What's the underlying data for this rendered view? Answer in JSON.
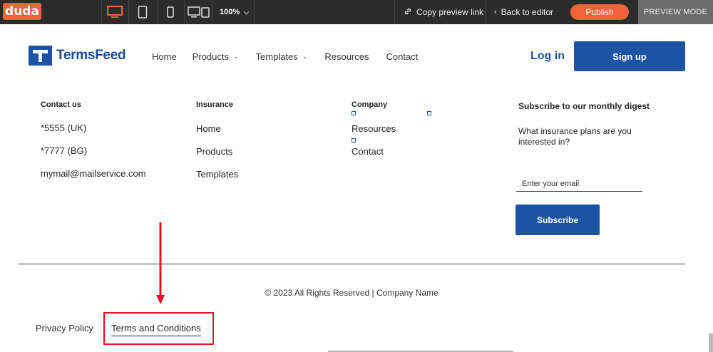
{
  "editor": {
    "logo": "duda",
    "zoom": "100%",
    "copy_link": "Copy preview link",
    "back": "Back to editor",
    "publish": "Publish",
    "mode": "PREVIEW MODE"
  },
  "header": {
    "brand": "TermsFeed",
    "nav": [
      "Home",
      "Products",
      "Templates",
      "Resources",
      "Contact"
    ],
    "login": "Log in",
    "signup": "Sign up"
  },
  "footer": {
    "contact": {
      "title": "Contact us",
      "items": [
        "*5555 (UK)",
        "*7777 (BG)",
        "mymail@mailservice.com"
      ]
    },
    "insurance": {
      "title": "Insurance",
      "items": [
        "Home",
        "Products",
        "Templates"
      ]
    },
    "company": {
      "title": "Company",
      "items": [
        "Resources",
        "Contact"
      ]
    },
    "subscribe": {
      "title": "Subscribe to our monthly digest",
      "question": "What insurance plans are you interested in?",
      "placeholder": "Enter your email",
      "button": "Subscribe"
    },
    "copyright": "© 2023 All Rights Reserved | Company Name",
    "privacy": "Privacy Policy",
    "terms": "Terms and Conditions"
  },
  "colors": {
    "accent": "#f4623a",
    "brand": "#1c53a4",
    "highlight": "#e2141c"
  }
}
